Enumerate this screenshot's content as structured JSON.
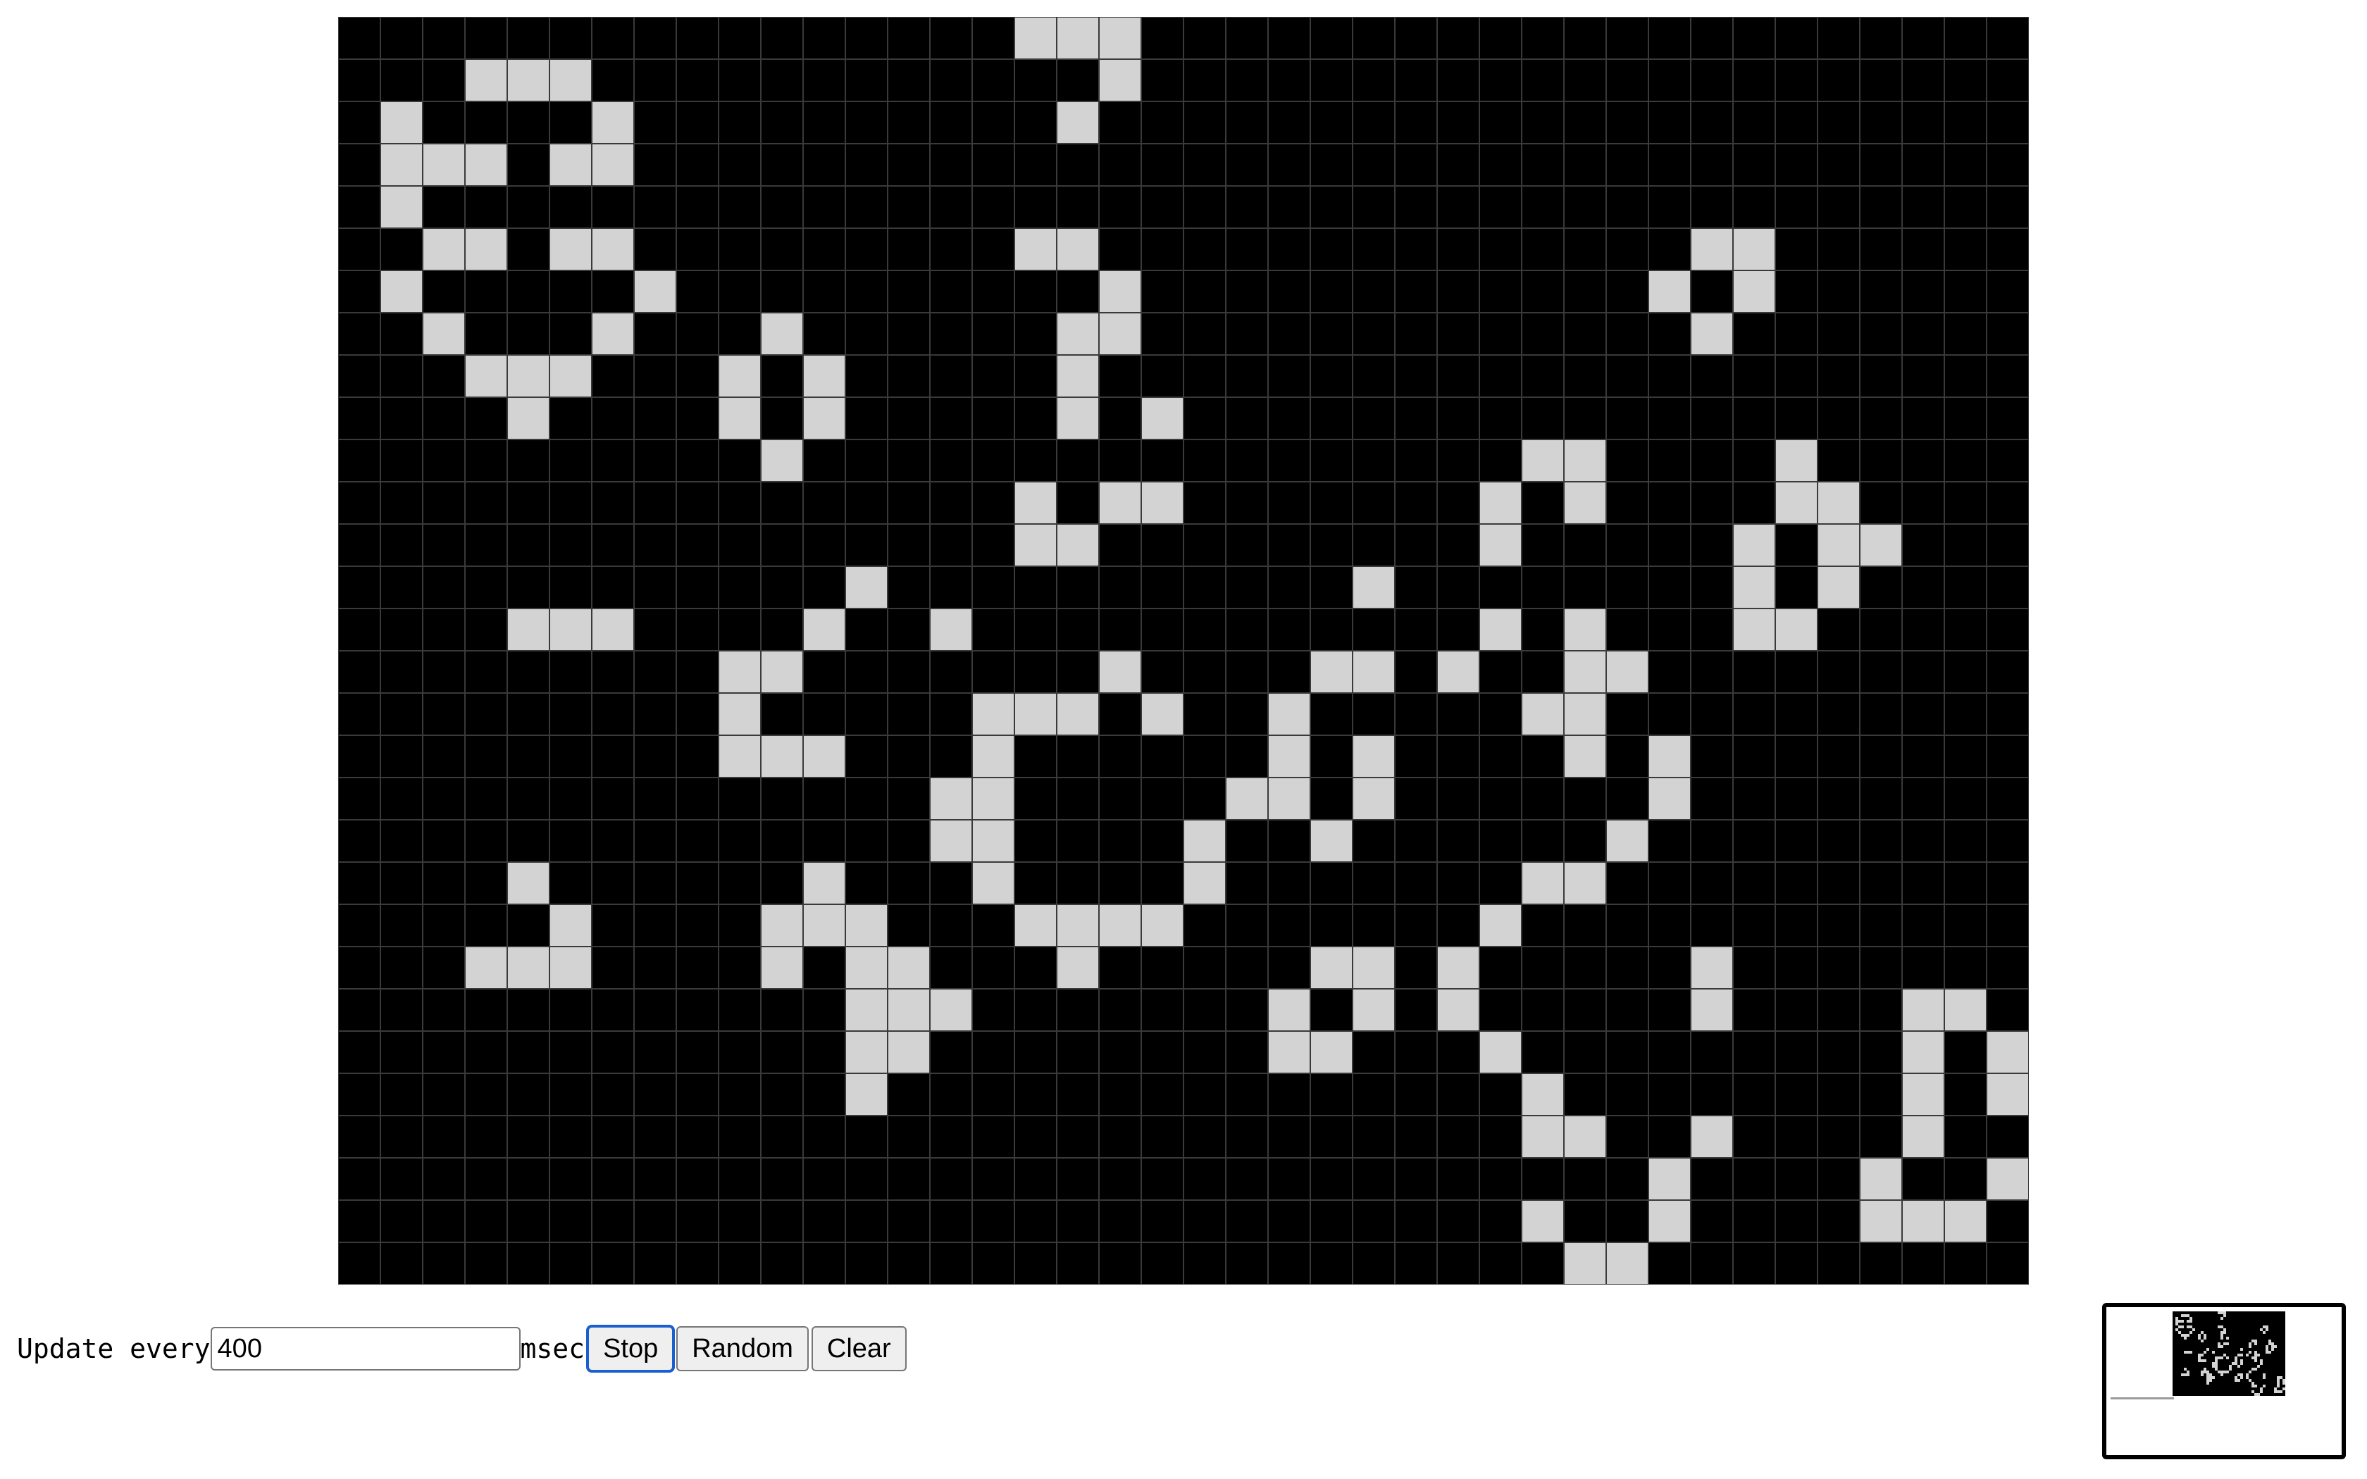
{
  "board": {
    "cols": 40,
    "rows": 30,
    "colors": {
      "dead": "#000000",
      "alive": "#d3d3d3",
      "gridline": "#3a3a3a"
    },
    "live_cells": [
      [
        0,
        16
      ],
      [
        0,
        17
      ],
      [
        0,
        18
      ],
      [
        1,
        3
      ],
      [
        1,
        4
      ],
      [
        1,
        5
      ],
      [
        1,
        18
      ],
      [
        2,
        1
      ],
      [
        2,
        6
      ],
      [
        2,
        17
      ],
      [
        3,
        1
      ],
      [
        3,
        2
      ],
      [
        3,
        3
      ],
      [
        3,
        5
      ],
      [
        3,
        6
      ],
      [
        4,
        1
      ],
      [
        5,
        2
      ],
      [
        5,
        3
      ],
      [
        5,
        5
      ],
      [
        5,
        6
      ],
      [
        5,
        16
      ],
      [
        5,
        17
      ],
      [
        5,
        32
      ],
      [
        5,
        33
      ],
      [
        6,
        1
      ],
      [
        6,
        7
      ],
      [
        6,
        18
      ],
      [
        6,
        31
      ],
      [
        6,
        33
      ],
      [
        7,
        2
      ],
      [
        7,
        6
      ],
      [
        7,
        10
      ],
      [
        7,
        17
      ],
      [
        7,
        18
      ],
      [
        7,
        32
      ],
      [
        8,
        3
      ],
      [
        8,
        4
      ],
      [
        8,
        5
      ],
      [
        8,
        9
      ],
      [
        8,
        11
      ],
      [
        8,
        17
      ],
      [
        9,
        4
      ],
      [
        9,
        9
      ],
      [
        9,
        11
      ],
      [
        9,
        17
      ],
      [
        9,
        19
      ],
      [
        10,
        10
      ],
      [
        10,
        28
      ],
      [
        10,
        29
      ],
      [
        10,
        34
      ],
      [
        11,
        16
      ],
      [
        11,
        18
      ],
      [
        11,
        19
      ],
      [
        11,
        27
      ],
      [
        11,
        29
      ],
      [
        11,
        34
      ],
      [
        11,
        35
      ],
      [
        12,
        16
      ],
      [
        12,
        17
      ],
      [
        12,
        27
      ],
      [
        12,
        33
      ],
      [
        12,
        35
      ],
      [
        12,
        36
      ],
      [
        13,
        12
      ],
      [
        13,
        24
      ],
      [
        13,
        33
      ],
      [
        13,
        35
      ],
      [
        14,
        4
      ],
      [
        14,
        5
      ],
      [
        14,
        6
      ],
      [
        14,
        11
      ],
      [
        14,
        14
      ],
      [
        14,
        27
      ],
      [
        14,
        29
      ],
      [
        14,
        33
      ],
      [
        14,
        34
      ],
      [
        15,
        9
      ],
      [
        15,
        10
      ],
      [
        15,
        18
      ],
      [
        15,
        23
      ],
      [
        15,
        24
      ],
      [
        15,
        26
      ],
      [
        15,
        29
      ],
      [
        15,
        30
      ],
      [
        16,
        9
      ],
      [
        16,
        15
      ],
      [
        16,
        16
      ],
      [
        16,
        17
      ],
      [
        16,
        19
      ],
      [
        16,
        22
      ],
      [
        16,
        28
      ],
      [
        16,
        29
      ],
      [
        17,
        9
      ],
      [
        17,
        10
      ],
      [
        17,
        11
      ],
      [
        17,
        15
      ],
      [
        17,
        22
      ],
      [
        17,
        24
      ],
      [
        17,
        29
      ],
      [
        17,
        31
      ],
      [
        18,
        14
      ],
      [
        18,
        15
      ],
      [
        18,
        21
      ],
      [
        18,
        22
      ],
      [
        18,
        24
      ],
      [
        18,
        31
      ],
      [
        19,
        14
      ],
      [
        19,
        15
      ],
      [
        19,
        20
      ],
      [
        19,
        23
      ],
      [
        19,
        30
      ],
      [
        20,
        4
      ],
      [
        20,
        11
      ],
      [
        20,
        15
      ],
      [
        20,
        20
      ],
      [
        20,
        28
      ],
      [
        20,
        29
      ],
      [
        21,
        5
      ],
      [
        21,
        10
      ],
      [
        21,
        11
      ],
      [
        21,
        12
      ],
      [
        21,
        16
      ],
      [
        21,
        17
      ],
      [
        21,
        18
      ],
      [
        21,
        19
      ],
      [
        21,
        27
      ],
      [
        22,
        3
      ],
      [
        22,
        4
      ],
      [
        22,
        5
      ],
      [
        22,
        10
      ],
      [
        22,
        12
      ],
      [
        22,
        13
      ],
      [
        22,
        17
      ],
      [
        22,
        23
      ],
      [
        22,
        24
      ],
      [
        22,
        26
      ],
      [
        22,
        32
      ],
      [
        23,
        12
      ],
      [
        23,
        13
      ],
      [
        23,
        14
      ],
      [
        23,
        22
      ],
      [
        23,
        24
      ],
      [
        23,
        26
      ],
      [
        23,
        32
      ],
      [
        23,
        37
      ],
      [
        23,
        38
      ],
      [
        24,
        12
      ],
      [
        24,
        13
      ],
      [
        24,
        22
      ],
      [
        24,
        23
      ],
      [
        24,
        27
      ],
      [
        24,
        37
      ],
      [
        24,
        39
      ],
      [
        25,
        12
      ],
      [
        25,
        28
      ],
      [
        25,
        37
      ],
      [
        25,
        39
      ],
      [
        26,
        28
      ],
      [
        26,
        29
      ],
      [
        26,
        32
      ],
      [
        26,
        37
      ],
      [
        27,
        31
      ],
      [
        27,
        36
      ],
      [
        27,
        39
      ],
      [
        28,
        28
      ],
      [
        28,
        31
      ],
      [
        28,
        36
      ],
      [
        28,
        37
      ],
      [
        28,
        38
      ],
      [
        29,
        29
      ],
      [
        29,
        30
      ]
    ]
  },
  "controls": {
    "update_label": "Update every",
    "interval_value": "400",
    "unit_label": "msec",
    "stop_label": "Stop",
    "random_label": "Random",
    "clear_label": "Clear"
  }
}
